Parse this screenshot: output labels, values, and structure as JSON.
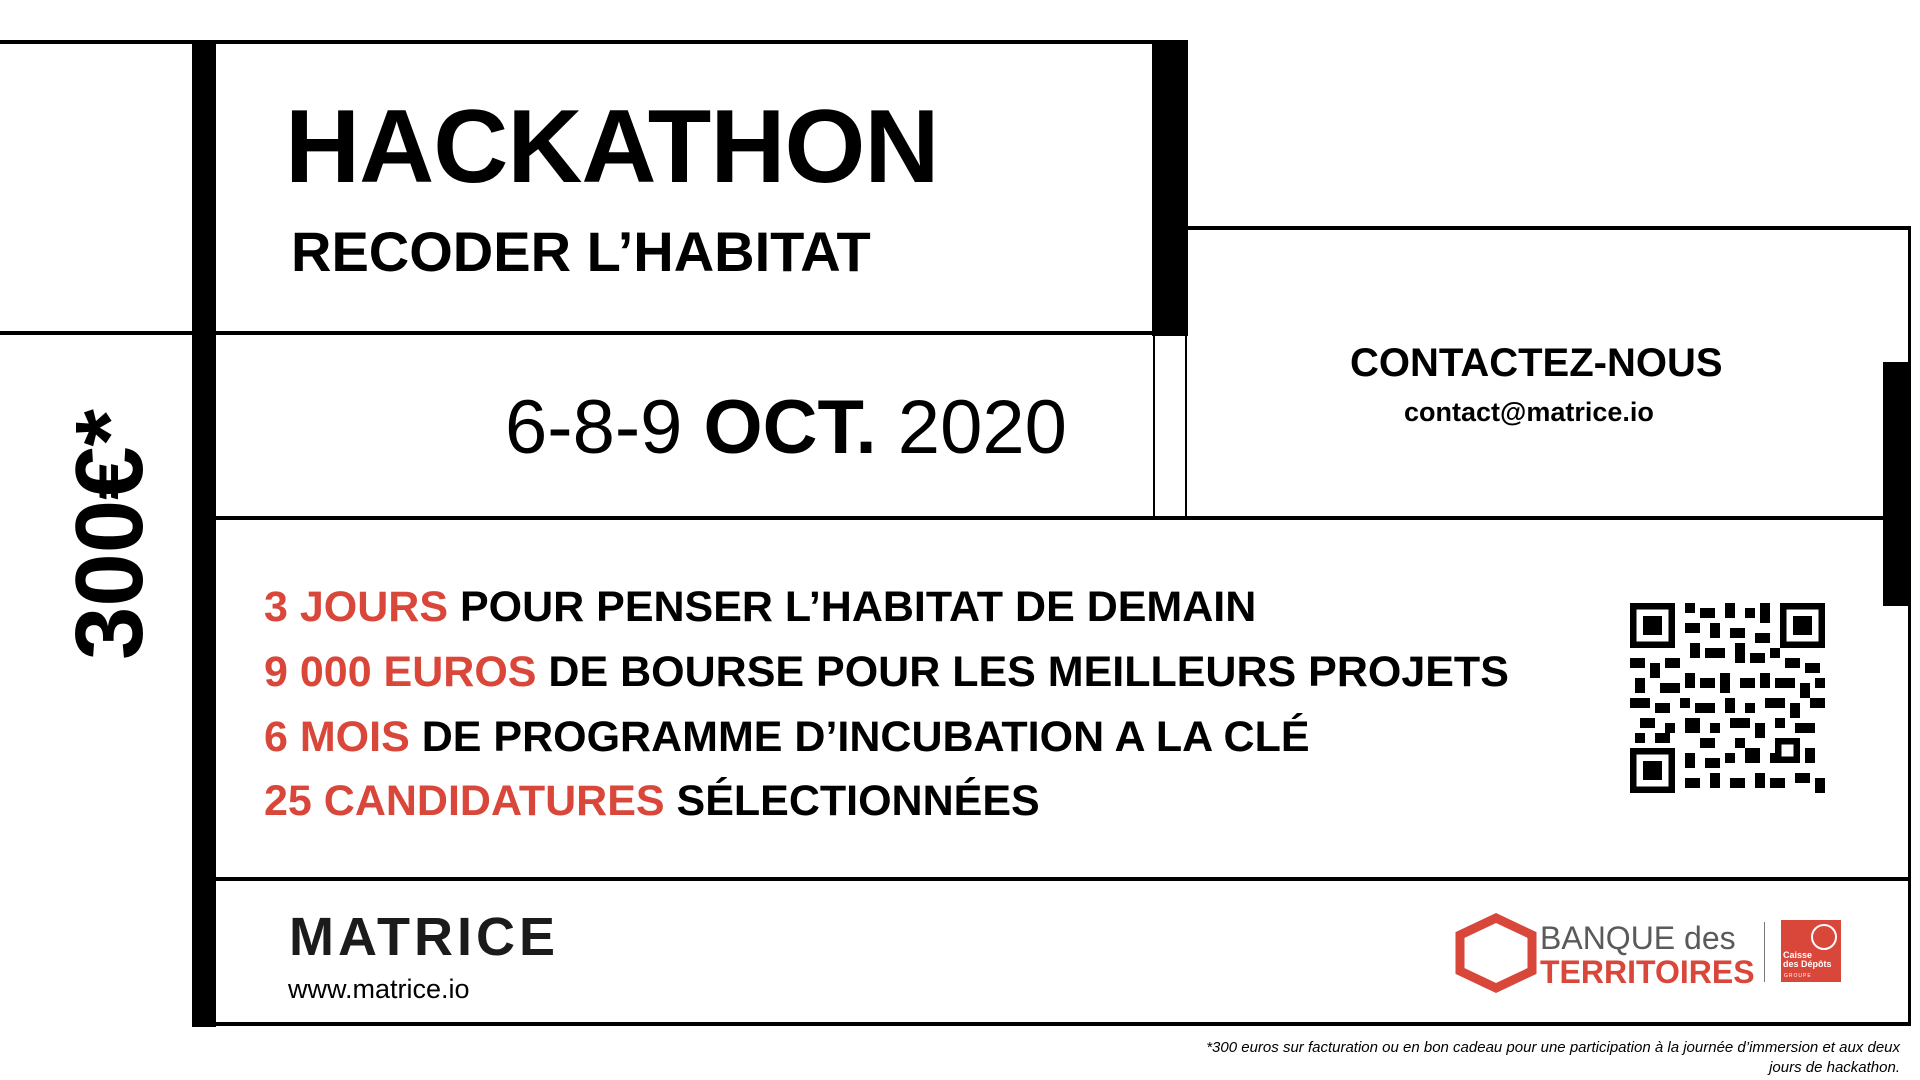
{
  "header": {
    "title": "HACKATHON",
    "subtitle": "RECODER L’HABITAT"
  },
  "dates": {
    "days": "6-8-9",
    "month": "OCT.",
    "year": "2020"
  },
  "contact": {
    "title": "CONTACTEZ-NOUS",
    "email": "contact@matrice.io"
  },
  "price": "300€*",
  "features": [
    {
      "highlight": "3 JOURS",
      "text": " POUR PENSER L’HABITAT DE DEMAIN"
    },
    {
      "highlight": "9 000 EUROS",
      "text": " DE BOURSE POUR LES MEILLEURS PROJETS"
    },
    {
      "highlight": "6 MOIS",
      "text": " DE PROGRAMME D’INCUBATION A LA CLÉ"
    },
    {
      "highlight": "25 CANDIDATURES",
      "text": " SÉLECTIONNÉES"
    }
  ],
  "matrice": {
    "logo": "MATRICE",
    "url": "www.matrice.io"
  },
  "banque": {
    "line1": "BANQUE des",
    "line2": "TERRITOIRES",
    "cdc_text": "Caisse\ndes Dépôts",
    "cdc_group": "GROUPE"
  },
  "footnote": "*300 euros sur facturation ou en bon cadeau pour une participation à la journée d’immersion et aux deux jours de hackathon.",
  "colors": {
    "accent": "#d9463a",
    "text": "#000000",
    "background": "#ffffff"
  }
}
